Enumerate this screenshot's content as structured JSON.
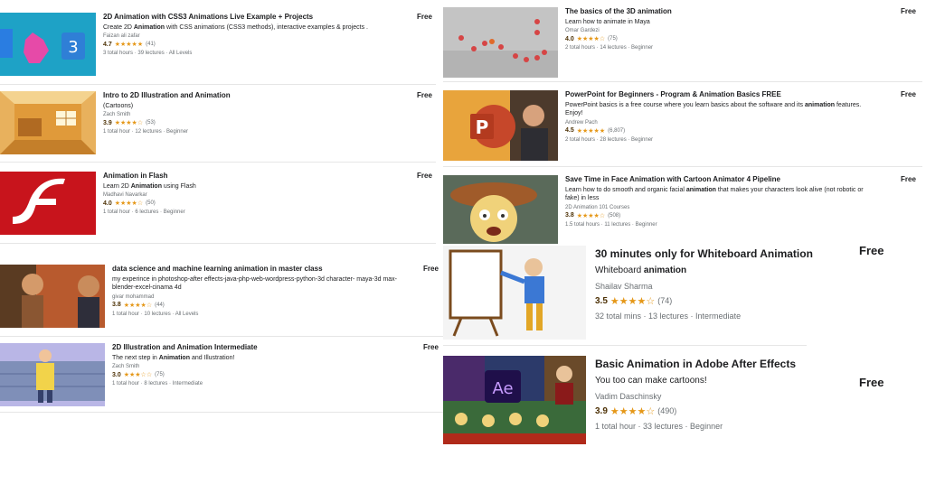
{
  "courses_left": [
    {
      "title": "2D Animation with CSS3 Animations Live Example + Projects",
      "desc_parts": [
        "Create 2D ",
        "Animation",
        " with CSS animations (CSS3 methods), interactive examples & projects ."
      ],
      "author": "Faizan ali zafar",
      "rating": "4.7",
      "stars": "★★★★★",
      "reviews": "(41)",
      "meta": "3 total hours · 39 lectures · All Levels",
      "price": "Free",
      "thumb": "css3"
    },
    {
      "title": "Intro to 2D Illustration and Animation",
      "desc_parts": [
        "(Cartoons)",
        "",
        ""
      ],
      "author": "Zach Smith",
      "rating": "3.9",
      "stars": "★★★★☆",
      "reviews": "(53)",
      "meta": "1 total hour · 12 lectures · Beginner",
      "price": "Free",
      "thumb": "room"
    },
    {
      "title": "Animation in Flash",
      "desc_parts": [
        "Learn 2D ",
        "Animation",
        " using Flash"
      ],
      "author": "Madhavi Navarkar",
      "rating": "4.0",
      "stars": "★★★★☆",
      "reviews": "(50)",
      "meta": "1 total hour · 6 lectures · Beginner",
      "price": "Free",
      "thumb": "flash"
    },
    {
      "title": "data science and machine learning animation in master class",
      "desc_parts": [
        "my experince in photoshop-after effects-java-php-web-wordpress-python-3d character- maya-3d max-blender-excel-cinama 4d",
        "",
        ""
      ],
      "author": "givar mohammad",
      "rating": "3.8",
      "stars": "★★★★☆",
      "reviews": "(44)",
      "meta": "1 total hour · 10 lectures · All Levels",
      "price": "Free",
      "thumb": "people"
    },
    {
      "title": "2D Illustration and Animation Intermediate",
      "desc_parts": [
        "The next step in ",
        "Animation",
        " and Illustration!"
      ],
      "author": "Zach Smith",
      "rating": "3.0",
      "stars": "★★★☆☆",
      "reviews": "(75)",
      "meta": "1 total hour · 8 lectures · Intermediate",
      "price": "Free",
      "thumb": "library"
    }
  ],
  "courses_right_small": [
    {
      "title": "The basics of the 3D animation",
      "desc_parts": [
        "Learn how to animate in Maya",
        "",
        ""
      ],
      "author": "Omar Gardezi",
      "rating": "4.0",
      "stars": "★★★★☆",
      "reviews": "(75)",
      "meta": "2 total hours · 14 lectures · Beginner",
      "price": "Free",
      "thumb": "balls"
    },
    {
      "title": "PowerPoint for Beginners - Program & Animation Basics FREE",
      "desc_parts": [
        "PowerPoint basics is a free course where you learn basics about the software and its ",
        "animation",
        " features. Enjoy!"
      ],
      "author": "Andrew Pach",
      "rating": "4.5",
      "stars": "★★★★★",
      "reviews": "(6,807)",
      "meta": "2 total hours · 28 lectures · Beginner",
      "price": "Free",
      "thumb": "powerpoint"
    },
    {
      "title": "Save Time in Face Animation with Cartoon Animator 4 Pipeline",
      "desc_parts": [
        "Learn how to do smooth and organic facial ",
        "animation",
        " that makes your characters look alive (not robotic or fake) in less"
      ],
      "author": "2D Animation 101 Courses",
      "rating": "3.8",
      "stars": "★★★★☆",
      "reviews": "(508)",
      "meta": "1.5 total hours · 11 lectures · Beginner",
      "price": "Free",
      "thumb": "cartoonface"
    }
  ],
  "courses_right_large": [
    {
      "title": "30 minutes only for Whiteboard Animation",
      "desc_parts": [
        "Whiteboard ",
        "animation",
        ""
      ],
      "author": "Shailav Sharma",
      "rating": "3.5",
      "stars": "★★★★☆",
      "reviews": "(74)",
      "meta": "32 total mins · 13 lectures · Intermediate",
      "price": "Free",
      "thumb": "whiteboard"
    },
    {
      "title": "Basic Animation in Adobe After Effects",
      "desc_parts": [
        "You too can make cartoons!",
        "",
        ""
      ],
      "author": "Vadim Daschinsky",
      "rating": "3.9",
      "stars": "★★★★☆",
      "reviews": "(490)",
      "meta": "1 total hour · 33 lectures · Beginner",
      "price": "Free",
      "thumb": "aftereffects"
    }
  ],
  "thumb_text": {
    "powerpoint_letter": "P",
    "ae_letters": "Ae"
  }
}
